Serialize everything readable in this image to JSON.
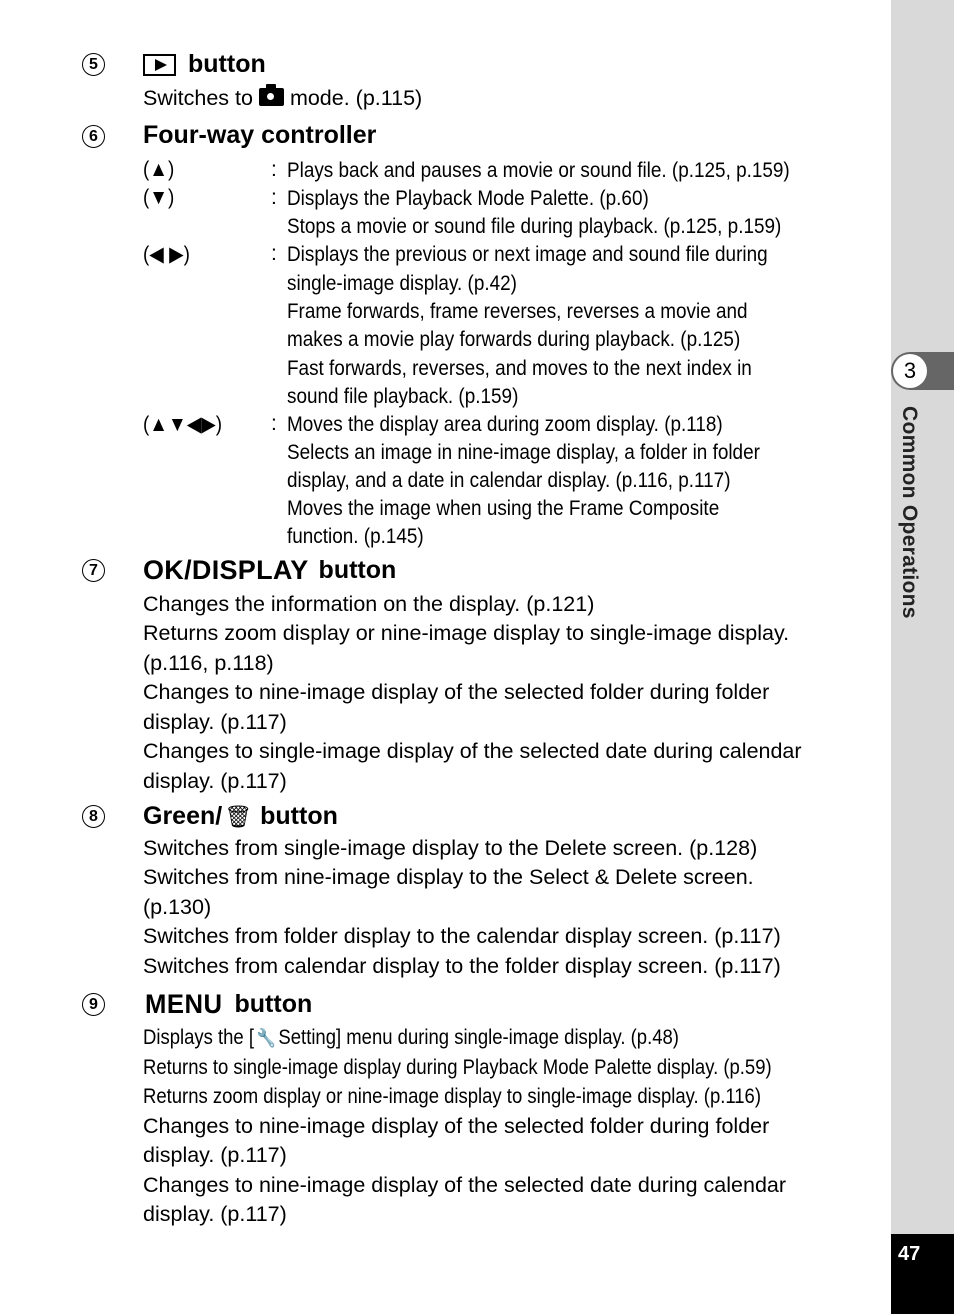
{
  "sidebar": {
    "chapter_number": "3",
    "chapter_title": "Common Operations",
    "page_number": "47",
    "colors": {
      "sidebar_bg": "#d9d9d9",
      "tab_bg": "#666666",
      "page_box_bg": "#000000"
    }
  },
  "sections": {
    "s5": {
      "number": "5",
      "icon": "playback-icon",
      "heading": "button",
      "lines": {
        "l0_a": "Switches to",
        "l0_icon": "camera-icon",
        "l0_b": "mode. (p.115)"
      }
    },
    "s6": {
      "number": "6",
      "heading": "Four-way controller",
      "rows": {
        "r0": {
          "key": "(▲)",
          "colon": ":",
          "desc": [
            "Plays back and pauses a movie or sound file. (p.125, p.159)"
          ]
        },
        "r1": {
          "key": "(▼)",
          "colon": ":",
          "desc": [
            "Displays the Playback Mode Palette. (p.60)",
            "Stops a movie or sound file during playback. (p.125, p.159)"
          ]
        },
        "r2": {
          "key": "(◀ ▶)",
          "colon": ":",
          "desc": [
            "Displays the previous or next image and sound file during",
            "single-image display. (p.42)",
            "Frame forwards, frame reverses, reverses a movie and",
            "makes a movie play forwards during playback. (p.125)",
            "Fast forwards, reverses, and moves to the next index in",
            "sound file playback. (p.159)"
          ]
        },
        "r3": {
          "key": "(▲▼◀▶)",
          "colon": ":",
          "desc": [
            "Moves the display area during zoom display. (p.118)",
            "Selects an image in nine-image display, a folder in folder",
            "display, and a date in calendar display. (p.116, p.117)",
            "Moves the image when using the Frame Composite",
            "function. (p.145)"
          ]
        }
      }
    },
    "s7": {
      "number": "7",
      "heading_key": "OK/DISPLAY",
      "heading": "button",
      "lines": [
        "Changes the information on the display. (p.121)",
        "Returns zoom display or nine-image display to single-image display.",
        "(p.116, p.118)",
        "Changes to nine-image display of the selected folder during folder",
        "display. (p.117)",
        "Changes to single-image display of the selected date during calendar",
        "display. (p.117)"
      ]
    },
    "s8": {
      "number": "8",
      "heading_key": "Green/",
      "icon": "trash-icon",
      "heading": "button",
      "lines": [
        "Switches from single-image display to the Delete screen. (p.128)",
        "Switches from nine-image display to the Select & Delete screen.",
        "(p.130)",
        "Switches from folder display to the calendar display screen. (p.117)",
        "Switches from calendar display to the folder display screen. (p.117)"
      ]
    },
    "s9": {
      "number": "9",
      "heading_key": "MENU",
      "heading": "button",
      "line0_a": "Displays the [",
      "line0_icon": "wrench-icon",
      "line0_b": "Setting] menu during single-image display. (p.48)",
      "lines": [
        "Returns to single-image display during Playback Mode Palette display. (p.59)",
        "Returns zoom display or nine-image display to single-image display. (p.116)",
        "Changes to nine-image display of the selected folder during folder",
        "display. (p.117)",
        "Changes to nine-image display of the selected date during calendar",
        "display. (p.117)"
      ]
    }
  }
}
